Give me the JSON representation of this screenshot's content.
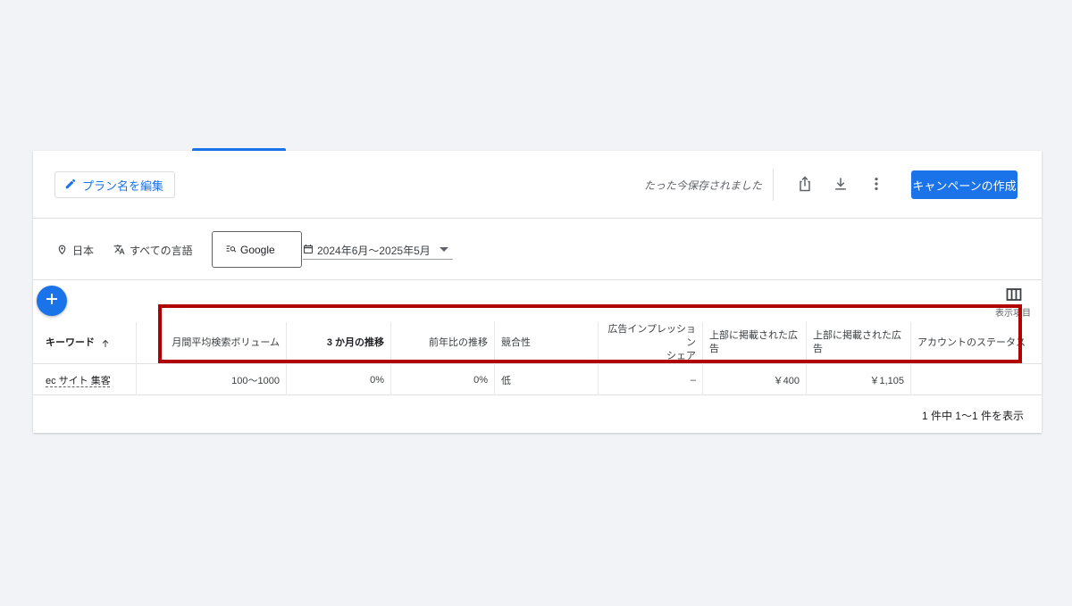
{
  "header": {
    "edit_plan_label": "プラン名を編集",
    "saved_status": "たった今保存されました",
    "create_campaign_label": "キャンペーンの作成",
    "icons": [
      "pencil-icon",
      "share-icon",
      "download-icon",
      "more-vert-icon"
    ]
  },
  "filters": {
    "location": "日本",
    "language": "すべての言語",
    "network": "Google",
    "date_range": "2024年6月〜2025年5月"
  },
  "toolbar": {
    "columns_label": "表示項目"
  },
  "table": {
    "columns": {
      "keyword": "キーワード",
      "monthly_volume": "月間平均検索ボリューム",
      "three_month_trend": "3 か月の推移",
      "yoy_trend": "前年比の推移",
      "competition": "競合性",
      "ad_impression_share_line1": "広告インプレッション",
      "ad_impression_share_line2": "シェア",
      "top_bid_low": "上部に掲載された広告",
      "top_bid_high": "上部に掲載された広告",
      "account_status": "アカウントのステータス"
    },
    "rows": [
      {
        "keyword": "ec サイト 集客",
        "monthly_volume": "100〜1000",
        "three_month_trend": "0%",
        "yoy_trend": "0%",
        "competition": "低",
        "ad_impression_share": "–",
        "top_bid_low": "￥400",
        "top_bid_high": "￥1,105",
        "account_status": ""
      }
    ],
    "pagination": "1 件中 1〜1 件を表示"
  },
  "colors": {
    "primary": "#1a73e8",
    "highlight_border": "#b00000"
  }
}
